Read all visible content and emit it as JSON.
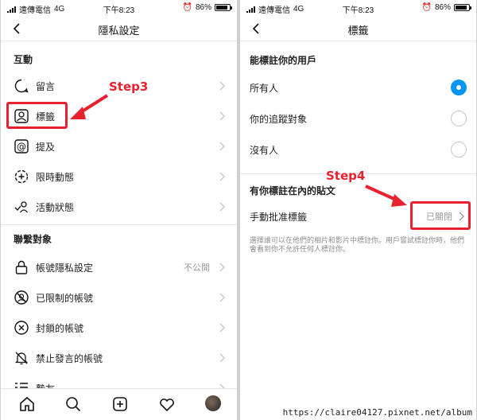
{
  "status_bar": {
    "carrier": "遠傳電信",
    "network": "4G",
    "time": "下午8:23",
    "battery_percent": "86%",
    "battery_level": 0.86
  },
  "left": {
    "title": "隱私設定",
    "sections": [
      {
        "header": "互動",
        "items": [
          {
            "label": "留言",
            "icon": "comment-icon"
          },
          {
            "label": "標籤",
            "icon": "tag-person-icon"
          },
          {
            "label": "提及",
            "icon": "at-icon"
          },
          {
            "label": "限時動態",
            "icon": "story-add-icon"
          },
          {
            "label": "活動狀態",
            "icon": "activity-status-icon"
          }
        ]
      },
      {
        "header": "聯繫對象",
        "items": [
          {
            "label": "帳號隱私設定",
            "icon": "lock-icon",
            "value": "不公開"
          },
          {
            "label": "已限制的帳號",
            "icon": "restricted-icon"
          },
          {
            "label": "封鎖的帳號",
            "icon": "blocked-icon"
          },
          {
            "label": "禁止發言的帳號",
            "icon": "mute-bell-icon"
          },
          {
            "label": "摯友",
            "icon": "close-friends-icon"
          }
        ]
      }
    ]
  },
  "right": {
    "title": "標籤",
    "tag_section_header": "能標註你的用戶",
    "options": [
      {
        "label": "所有人",
        "selected": true
      },
      {
        "label": "你的追蹤對象",
        "selected": false
      },
      {
        "label": "沒有人",
        "selected": false
      }
    ],
    "posts_section_header": "有你標註在內的貼文",
    "manual_approve": {
      "label": "手動批准標籤",
      "value": "已關閉"
    },
    "description": "選擇誰可以在他們的相片和影片中標註你。用戶嘗試標註你時，他們會看到你不允許任何人標註你。"
  },
  "annotations": {
    "step3": "Step3",
    "step4": "Step4",
    "color": "#e8212e"
  },
  "watermark": "https://claire04127.pixnet.net/album",
  "colors": {
    "accent": "#0095f6",
    "annotation": "#e8212e"
  }
}
